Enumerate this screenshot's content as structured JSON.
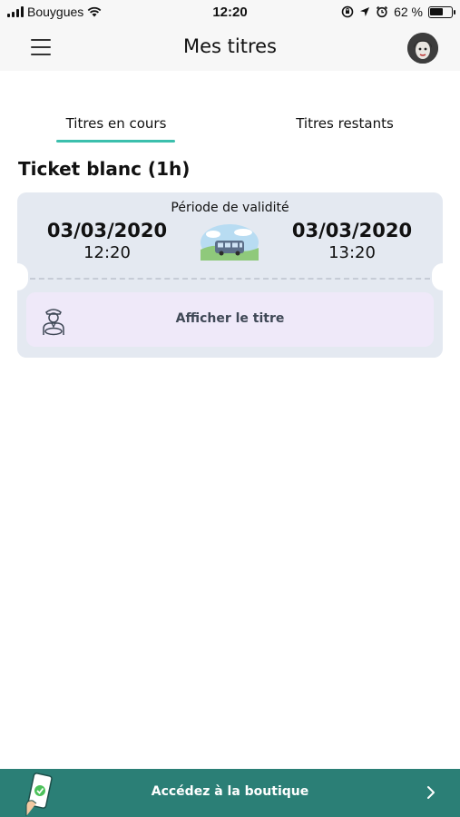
{
  "status_bar": {
    "carrier": "Bouygues",
    "time": "12:20",
    "battery_percent_text": "62 %",
    "battery_level": 0.62
  },
  "header": {
    "title": "Mes titres"
  },
  "tabs": [
    {
      "label": "Titres en cours",
      "active": true
    },
    {
      "label": "Titres restants",
      "active": false
    }
  ],
  "ticket": {
    "name": "Ticket blanc (1h)",
    "validity_label": "Période de validité",
    "start_date": "03/03/2020",
    "start_time": "12:20",
    "end_date": "03/03/2020",
    "end_time": "13:20",
    "show_button_label": "Afficher le titre"
  },
  "shop_bar": {
    "label": "Accédez à la boutique"
  },
  "colors": {
    "accent": "#3bbfad",
    "shop_bar": "#2b7f76",
    "ticket_card": "#e4e9f1",
    "show_button": "#efe9f9"
  }
}
